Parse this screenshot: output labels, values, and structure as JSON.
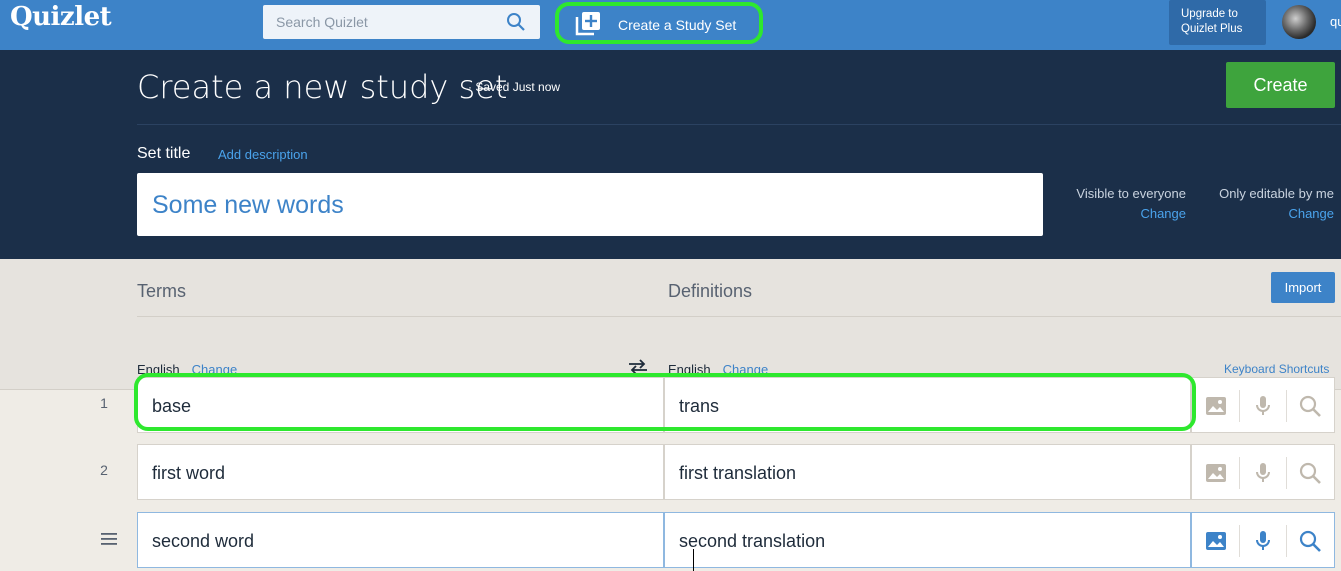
{
  "topbar": {
    "logo": "Quizlet",
    "search_placeholder": "Search Quizlet",
    "create_set_label": "Create a Study Set",
    "upgrade_line1": "Upgrade to",
    "upgrade_line2": "Quizlet Plus",
    "user_fragment": "qu"
  },
  "header": {
    "title": "Create a new study set",
    "saved_status": "· Saved Just now",
    "create_button": "Create",
    "set_title_label": "Set title",
    "add_description": "Add description",
    "set_title_value": "Some new words",
    "visibility": "Visible to everyone",
    "visibility_change": "Change",
    "editability": "Only editable by me",
    "editability_change": "Change"
  },
  "columns": {
    "terms_header": "Terms",
    "definitions_header": "Definitions",
    "import_button": "Import",
    "term_language": "English",
    "term_language_change": "Change",
    "definition_language": "English",
    "definition_language_change": "Change",
    "keyboard_shortcuts": "Keyboard Shortcuts"
  },
  "cards": [
    {
      "number": "1",
      "term": "base",
      "definition": "trans"
    },
    {
      "number": "2",
      "term": "first word",
      "definition": "first translation"
    },
    {
      "number": "",
      "term": "second word",
      "definition": "second translation"
    }
  ],
  "colors": {
    "brand_blue": "#3d83c8",
    "header_navy": "#1b2f49",
    "create_green": "#3ea43d",
    "highlight_green": "#2ee82e"
  }
}
